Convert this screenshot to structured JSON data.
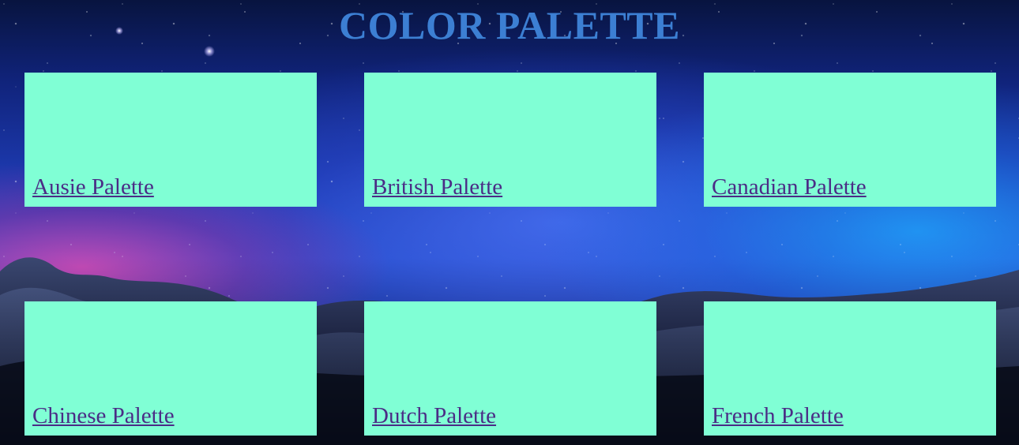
{
  "page": {
    "title": "COLOR PALETTE"
  },
  "palettes": [
    {
      "label": "Ausie Palette"
    },
    {
      "label": "British Palette"
    },
    {
      "label": "Canadian Palette"
    },
    {
      "label": "Chinese Palette"
    },
    {
      "label": "Dutch Palette"
    },
    {
      "label": "French Palette"
    }
  ],
  "colors": {
    "title": "#3c7fd3",
    "card_background": "#80ffd5",
    "link": "#4b2c86"
  },
  "background": {
    "scene": "night sky with stars over rocks"
  }
}
